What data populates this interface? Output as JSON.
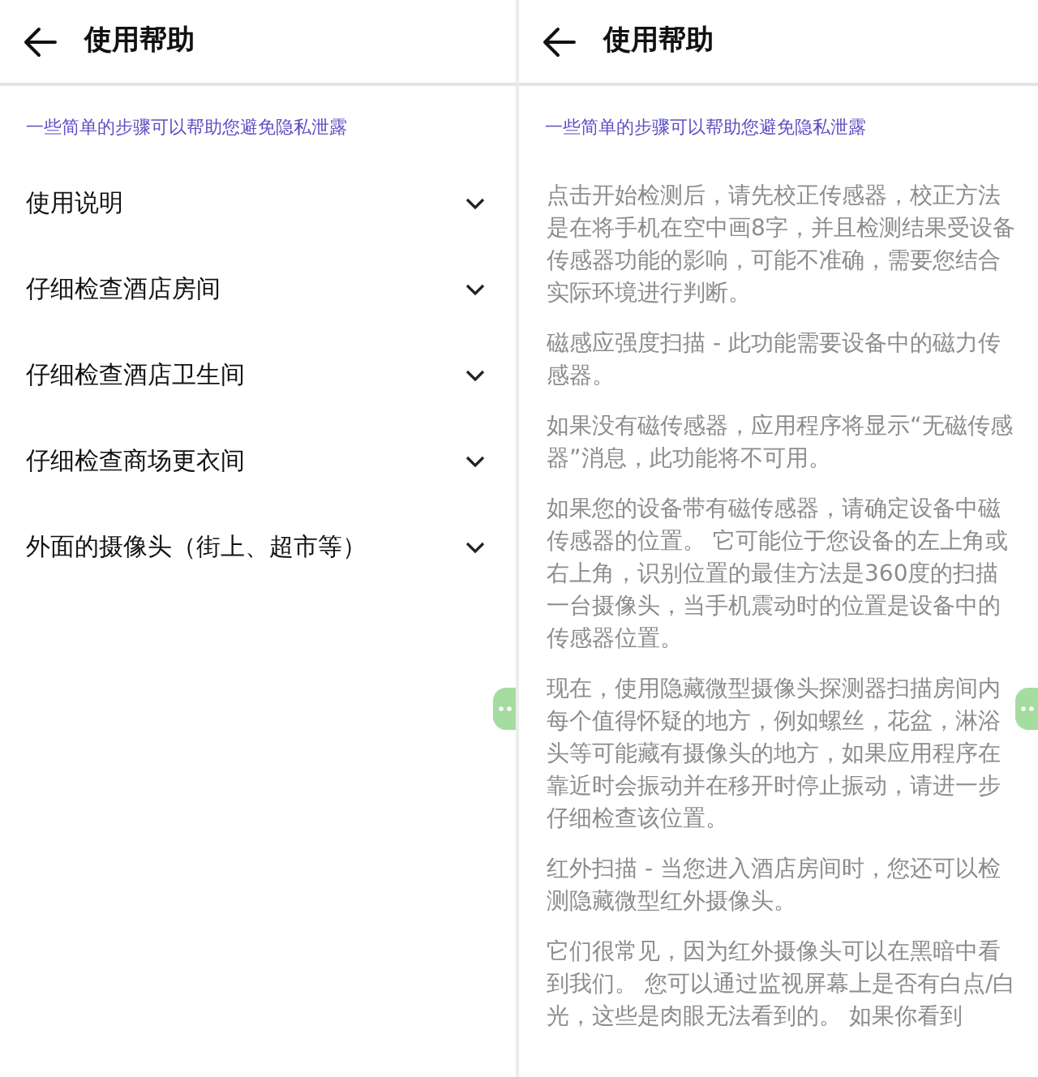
{
  "panels": [
    {
      "kind": "list",
      "title": "使用帮助",
      "subtitle": "一些简单的步骤可以帮助您避免隐私泄露",
      "items": [
        {
          "label": "使用说明",
          "expanded": false
        },
        {
          "label": "仔细检查酒店房间",
          "expanded": false
        },
        {
          "label": "仔细检查酒店卫生间",
          "expanded": false
        },
        {
          "label": "仔细检查商场更衣间",
          "expanded": false
        },
        {
          "label": "外面的摄像头（街上、超市等）",
          "expanded": false
        }
      ]
    },
    {
      "kind": "article",
      "title": "使用帮助",
      "subtitle": "一些简单的步骤可以帮助您避免隐私泄露",
      "paragraphs": [
        "点击开始检测后，请先校正传感器，校正方法是在将手机在空中画8字，并且检测结果受设备传感器功能的影响，可能不准确，需要您结合实际环境进行判断。",
        "磁感应强度扫描 - 此功能需要设备中的磁力传感器。",
        "如果没有磁传感器，应用程序将显示“无磁传感器”消息，此功能将不可用。",
        "如果您的设备带有磁传感器，请确定设备中磁传感器的位置。 它可能位于您设备的左上角或右上角，识别位置的最佳方法是360度的扫描一台摄像头，当手机震动时的位置是设备中的传感器位置。",
        "现在，使用隐藏微型摄像头探测器扫描房间内每个值得怀疑的地方，例如螺丝，花盆，淋浴头等可能藏有摄像头的地方，如果应用程序在靠近时会振动并在移开时停止振动，请进一步仔细检查该位置。",
        "红外扫描 - 当您进入酒店房间时，您还可以检测隐藏微型红外摄像头。",
        "它们很常见，因为红外摄像头可以在黑暗中看到我们。 您可以通过监视屏幕上是否有白点/白光，这些是肉眼无法看到的。 如果你看到"
      ]
    }
  ]
}
